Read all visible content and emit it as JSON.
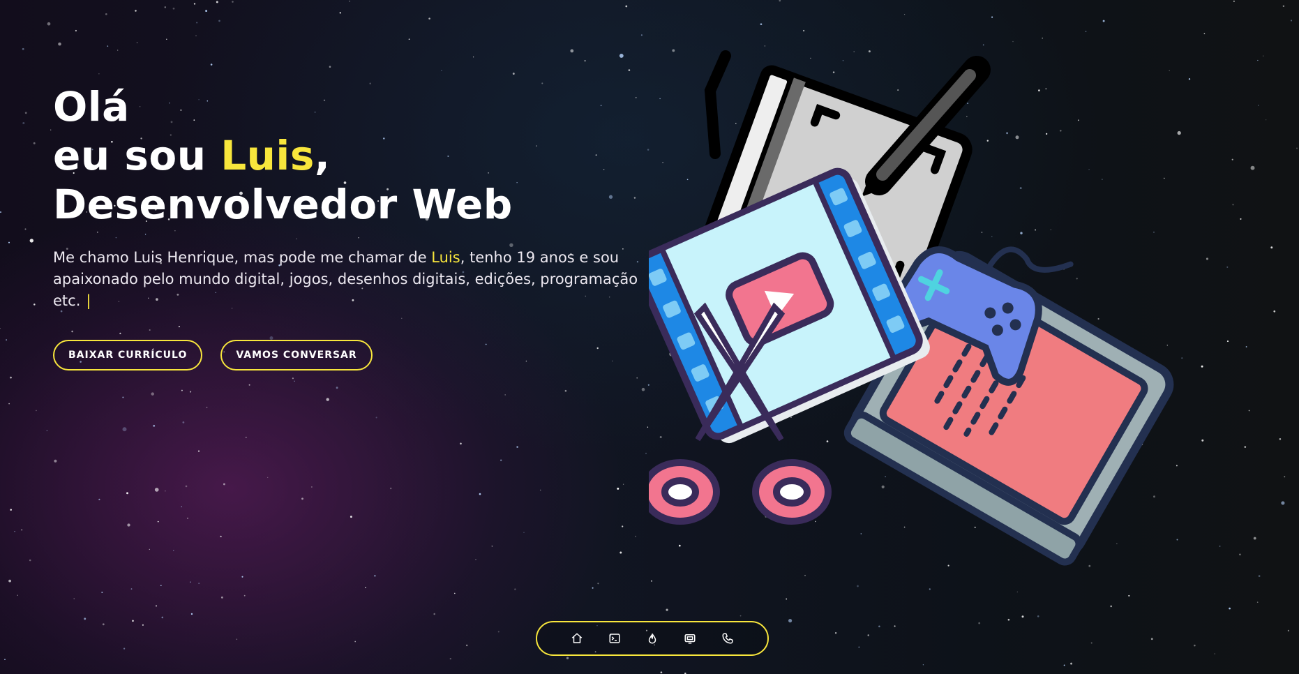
{
  "hero": {
    "greeting": "Olá",
    "intro_prefix": "eu sou ",
    "name": "Luis",
    "intro_suffix": ",",
    "role": "Desenvolvedor Web",
    "description_part1": "Me chamo Luis Henrique, mas pode me chamar de ",
    "description_name": "Luis",
    "description_part2": ", tenho 19 anos e sou apaixonado pelo mundo digital, jogos, desenhos digitais, edições, programação etc.",
    "typing_cursor": "|",
    "buttons": {
      "resume": "BAIXAR CURRÍCULO",
      "contact": "VAMOS CONVERSAR"
    }
  },
  "dock": {
    "items": [
      {
        "icon": "home-icon"
      },
      {
        "icon": "terminal-icon"
      },
      {
        "icon": "flame-icon"
      },
      {
        "icon": "projects-icon"
      },
      {
        "icon": "phone-icon"
      }
    ]
  },
  "colors": {
    "accent": "#f8e63c",
    "text": "#ffffff"
  }
}
